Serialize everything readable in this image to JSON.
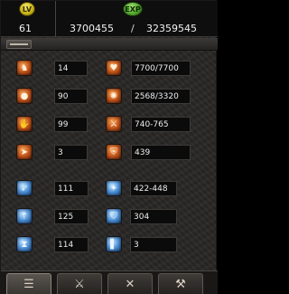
{
  "header": {
    "level_badge": "LV",
    "level": "61",
    "exp_badge": "EXP",
    "exp_current": "3700455",
    "exp_separator": "/",
    "exp_max": "32359545"
  },
  "stats_left": [
    {
      "icon": "strength-icon",
      "glyph": "♞",
      "value": "14",
      "hp_value": "7700/7700",
      "right_icon": "heart-icon",
      "right_glyph": "♥"
    },
    {
      "icon": "head-icon",
      "glyph": "●",
      "value": "90",
      "hp_value": "2568/3320",
      "right_icon": "mana-orb-icon",
      "right_glyph": "✺"
    },
    {
      "icon": "dexterity-icon",
      "glyph": "✋",
      "value": "99",
      "hp_value": "740-765",
      "right_icon": "attack-icon",
      "right_glyph": "⚔"
    },
    {
      "icon": "speed-icon",
      "glyph": "➤",
      "value": "3",
      "hp_value": "439",
      "right_icon": "defense-shield-icon",
      "right_glyph": "⛨"
    }
  ],
  "stats_right": [
    {
      "icon": "agility-icon",
      "glyph": "➶",
      "value": "111",
      "right_icon": "magic-attack-icon",
      "right_glyph": "✦",
      "right_value": "422-448"
    },
    {
      "icon": "arrow-rise-icon",
      "glyph": "⇡",
      "value": "125",
      "right_icon": "magic-shield-icon",
      "right_glyph": "⛉",
      "right_value": "304"
    },
    {
      "icon": "hourglass-icon",
      "glyph": "⧗",
      "value": "114",
      "right_icon": "bar-icon",
      "right_glyph": "▌",
      "right_value": "3"
    }
  ],
  "tabs": [
    {
      "name": "tab-character",
      "icon": "character-card-icon",
      "glyph": "☰",
      "active": true
    },
    {
      "name": "tab-skills",
      "icon": "sword-icon",
      "glyph": "⚔",
      "active": false
    },
    {
      "name": "tab-combat",
      "icon": "crossed-swords-icon",
      "glyph": "✕",
      "active": false
    },
    {
      "name": "tab-extra",
      "icon": "blade-icon",
      "glyph": "⚒",
      "active": false
    }
  ]
}
